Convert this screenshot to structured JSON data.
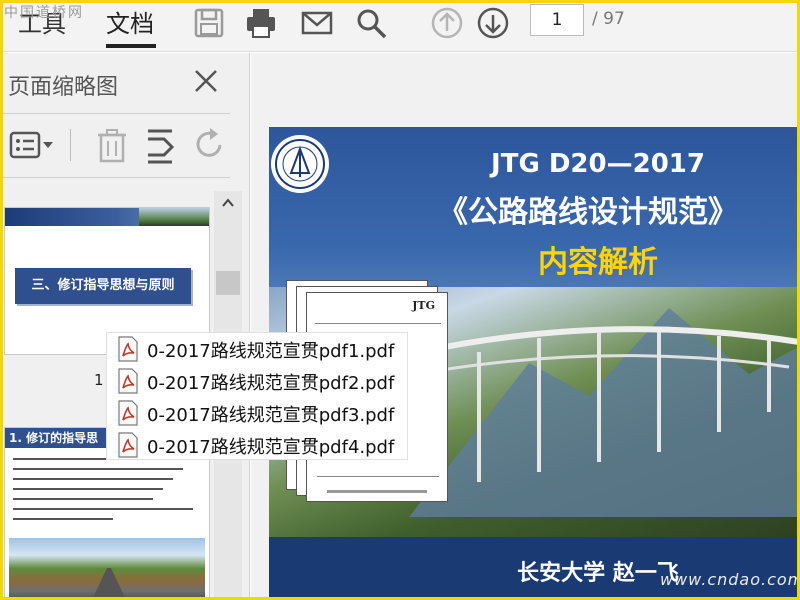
{
  "toolbar": {
    "tabs": [
      {
        "label": "工具"
      },
      {
        "label": "文档"
      }
    ],
    "active_tab": "文档",
    "icons": [
      "save-icon",
      "print-icon",
      "email-icon",
      "search-icon",
      "page-up-icon",
      "page-down-icon"
    ],
    "page": {
      "current": "1",
      "total": "/ 97"
    }
  },
  "watermark": {
    "top_left": "中国道桥网",
    "bottom_right": "www.cndao.com"
  },
  "left_panel": {
    "title": "页面缩略图",
    "tools": [
      "thumbnail-options-icon",
      "delete-page-icon",
      "extract-page-icon",
      "rotate-page-icon"
    ],
    "thumbnails": [
      {
        "heading": "三、修订指导思想与原则",
        "page_label": "1"
      },
      {
        "heading": "1. 修订的指导思"
      }
    ]
  },
  "slide": {
    "title_line1": "JTG D20—2017",
    "title_line2": "《公路路线设计规范》",
    "title_line3": "内容解析",
    "author": "长安大学  赵一飞",
    "accent_yellow": "#ffd400",
    "brand_blue": "#2c5497"
  },
  "doc_stack": {
    "label": "JTG"
  },
  "drag_files": [
    {
      "name": "0-2017路线规范宣贯pdf1.pdf"
    },
    {
      "name": "0-2017路线规范宣贯pdf2.pdf"
    },
    {
      "name": "0-2017路线规范宣贯pdf3.pdf"
    },
    {
      "name": "0-2017路线规范宣贯pdf4.pdf"
    }
  ]
}
